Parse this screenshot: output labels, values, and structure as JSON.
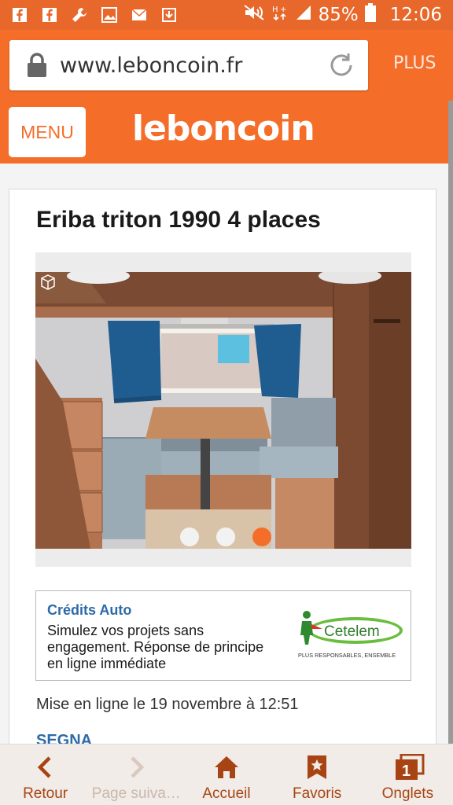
{
  "status_bar": {
    "battery": "85%",
    "time": "12:06",
    "icons": [
      "facebook-icon",
      "facebook-icon",
      "wrench-icon",
      "image-icon",
      "mail-icon",
      "download-icon",
      "mute-icon",
      "data-icon",
      "signal-icon",
      "battery-icon"
    ]
  },
  "browser": {
    "url": "www.leboncoin.fr",
    "plus_label": "PLUS"
  },
  "header": {
    "menu_label": "MENU",
    "logo_text": "leboncoin"
  },
  "listing": {
    "title": "Eriba triton 1990 4 places",
    "gallery": {
      "slide_count": 3,
      "active_slide": 3
    },
    "promo": {
      "title": "Crédits Auto",
      "text": "Simulez vos projets sans engagement. Réponse de principe en ligne immédiate",
      "brand": "Cetelem",
      "tagline": "PLUS RESPONSABLES, ENSEMBLE"
    },
    "posted": "Mise en ligne le 19 novembre à 12:51",
    "seller": "SEGNA"
  },
  "bottom_nav": [
    {
      "label": "Retour",
      "icon": "chevron-left-icon",
      "enabled": true
    },
    {
      "label": "Page suiva…",
      "icon": "chevron-right-icon",
      "enabled": false
    },
    {
      "label": "Accueil",
      "icon": "home-icon",
      "enabled": true
    },
    {
      "label": "Favoris",
      "icon": "bookmark-star-icon",
      "enabled": true
    },
    {
      "label": "Onglets",
      "icon": "tabs-icon",
      "enabled": true,
      "badge": "1"
    }
  ],
  "colors": {
    "brand_orange": "#f46e2a",
    "link_blue": "#2e6aa8",
    "nav_brown": "#a84414"
  }
}
